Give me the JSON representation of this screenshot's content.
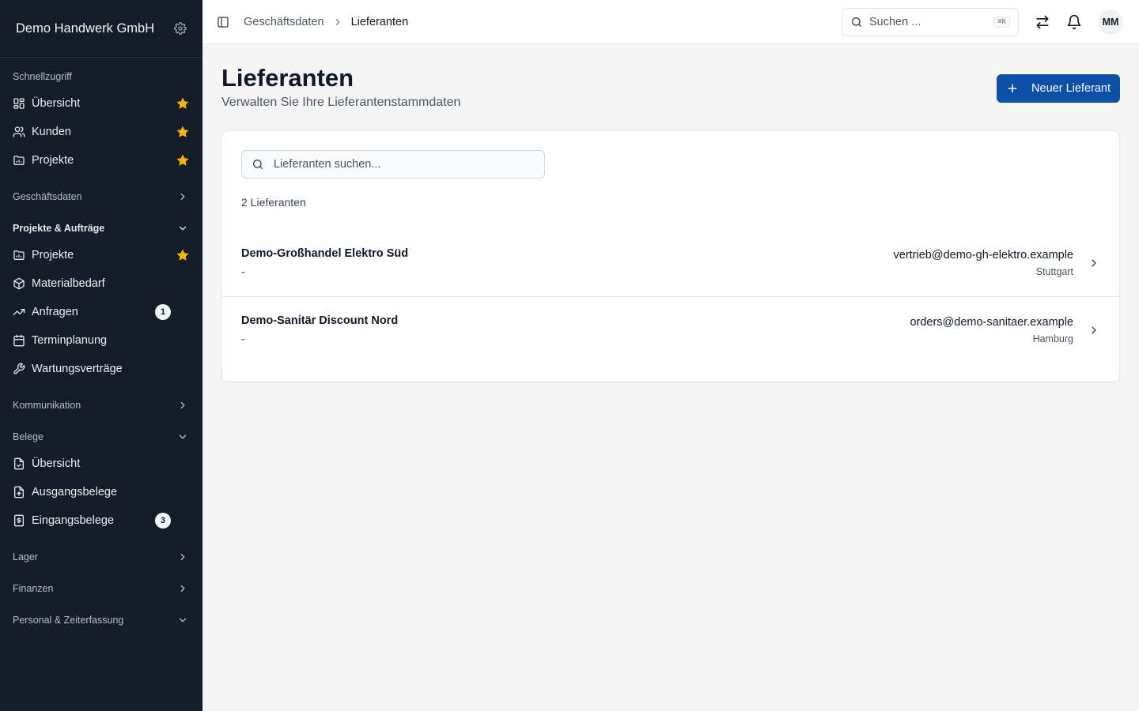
{
  "sidebar": {
    "company": "Demo Handwerk GmbH",
    "groups": [
      {
        "title": "Schnellzugriff",
        "items": [
          {
            "label": "Übersicht"
          },
          {
            "label": "Kunden"
          },
          {
            "label": "Projekte"
          }
        ]
      },
      {
        "title": "Geschäftsdaten"
      },
      {
        "title": "Projekte & Aufträge",
        "items": [
          {
            "label": "Projekte"
          },
          {
            "label": "Materialbedarf"
          },
          {
            "label": "Anfragen",
            "badge": "1"
          },
          {
            "label": "Terminplanung"
          },
          {
            "label": "Wartungsverträge"
          }
        ]
      },
      {
        "title": "Kommunikation"
      },
      {
        "title": "Belege",
        "items": [
          {
            "label": "Übersicht"
          },
          {
            "label": "Ausgangsbelege"
          },
          {
            "label": "Eingangsbelege",
            "badge": "3"
          }
        ]
      },
      {
        "title": "Lager"
      },
      {
        "title": "Finanzen"
      },
      {
        "title": "Personal & Zeiterfassung"
      }
    ]
  },
  "topbar": {
    "breadcrumb": [
      "Geschäftsdaten",
      "Lieferanten"
    ],
    "search_placeholder": "Suchen ...",
    "shortcut": "⌘K",
    "avatar_initials": "MM"
  },
  "page": {
    "title": "Lieferanten",
    "subtitle": "Verwalten Sie Ihre Lieferantenstammdaten",
    "new_button": "Neuer Lieferant",
    "search_placeholder": "Lieferanten suchen...",
    "count_label": "2 Lieferanten",
    "suppliers": [
      {
        "name": "Demo-Großhandel Elektro Süd",
        "subline": "-",
        "email": "vertrieb@demo-gh-elektro.example",
        "city": "Stuttgart"
      },
      {
        "name": "Demo-Sanitär Discount Nord",
        "subline": "-",
        "email": "orders@demo-sanitaer.example",
        "city": "Hamburg"
      }
    ]
  },
  "colors": {
    "sidebar_bg": "#131c28",
    "primary": "#0d4ea6",
    "star": "#f5b400"
  }
}
